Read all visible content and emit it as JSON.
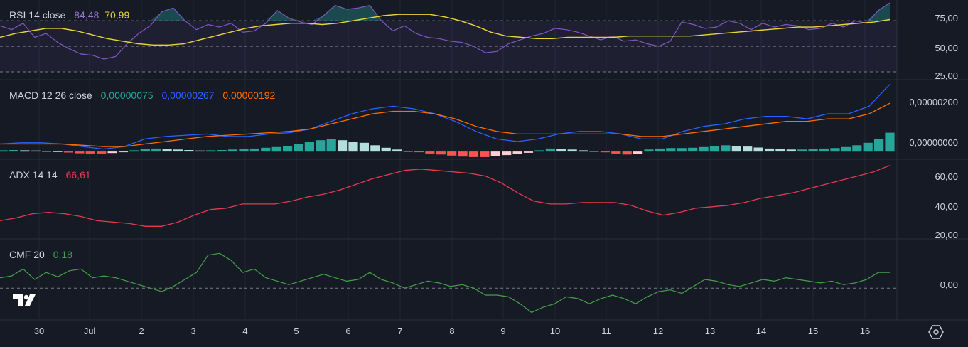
{
  "colors": {
    "background": "#161a25",
    "grid": "#232733",
    "rsi_line": "#7e57c2",
    "rsi_ma": "#e8d534",
    "macd_line": "#2962ff",
    "signal_line": "#ff6d00",
    "hist_pos_strong": "#26a69a",
    "hist_pos_weak": "#b2dfdb",
    "hist_neg_strong": "#ff5252",
    "hist_neg_weak": "#ffcdd2",
    "adx_line": "#e53950",
    "cmf_line": "#43a047"
  },
  "icons": {
    "logo": "tradingview-logo-icon",
    "settings": "settings-hexagon-icon"
  },
  "chart_data": [
    {
      "type": "line",
      "pane": "rsi",
      "title": "RSI 14 close",
      "legend_values": [
        "84,48",
        "70,99"
      ],
      "ylim": [
        25,
        84
      ],
      "yticks": [
        "75,00",
        "50,00",
        "25,00"
      ],
      "bands": [
        30,
        50,
        70
      ],
      "x": [
        "30",
        "Jul",
        "2",
        "3",
        "4",
        "5",
        "6",
        "7",
        "8",
        "9",
        "10",
        "11",
        "12",
        "13",
        "14",
        "15",
        "16"
      ],
      "series": [
        {
          "name": "RSI",
          "values": [
            66,
            63,
            68,
            57,
            60,
            53,
            48,
            44,
            43,
            40,
            42,
            52,
            60,
            66,
            77,
            80,
            70,
            63,
            67,
            65,
            68,
            61,
            62,
            68,
            78,
            72,
            69,
            67,
            74,
            82,
            79,
            80,
            82,
            70,
            62,
            66,
            60,
            57,
            56,
            54,
            53,
            50,
            45,
            46,
            52,
            55,
            58,
            60,
            64,
            63,
            61,
            58,
            55,
            58,
            54,
            55,
            52,
            50,
            54,
            69,
            67,
            64,
            65,
            70,
            68,
            63,
            68,
            65,
            67,
            66,
            63,
            64,
            68,
            65,
            70,
            68,
            78,
            84
          ]
        },
        {
          "name": "MA",
          "values": [
            57,
            60,
            62,
            64,
            64,
            62,
            59,
            56,
            54,
            52,
            51,
            51,
            52,
            55,
            58,
            61,
            64,
            66,
            67,
            68,
            68,
            67,
            68,
            70,
            72,
            74,
            75,
            75,
            75,
            73,
            70,
            66,
            61,
            58,
            57,
            56,
            56,
            57,
            57,
            57,
            57,
            58,
            58,
            58,
            58,
            58,
            59,
            60,
            61,
            62,
            63,
            64,
            65,
            65,
            66,
            67,
            68,
            69,
            71
          ]
        }
      ]
    },
    {
      "type": "bar",
      "pane": "macd",
      "title": "MACD 12 26 close",
      "legend_values": [
        "0,00000075",
        "0,00000267",
        "0,00000192"
      ],
      "ylim": [
        -2.5e-07,
        2.8e-06
      ],
      "yticks": [
        "0,00000200",
        "0,00000000"
      ],
      "series": [
        {
          "name": "MACD",
          "values": [
            3e-07,
            3.5e-07,
            3.5e-07,
            3e-07,
            2e-07,
            1e-07,
            2e-07,
            5e-07,
            6e-07,
            6.5e-07,
            7e-07,
            6e-07,
            6e-07,
            7e-07,
            7.5e-07,
            9e-07,
            1.2e-06,
            1.5e-06,
            1.7e-06,
            1.8e-06,
            1.7e-06,
            1.5e-06,
            1.2e-06,
            8e-07,
            5e-07,
            4e-07,
            5e-07,
            7e-07,
            8e-07,
            8e-07,
            7e-07,
            5e-07,
            5e-07,
            8e-07,
            1e-06,
            1.1e-06,
            1.3e-06,
            1.4e-06,
            1.4e-06,
            1.3e-06,
            1.5e-06,
            1.5e-06,
            1.8e-06,
            2.67e-06
          ]
        },
        {
          "name": "Signal",
          "values": [
            3e-07,
            3e-07,
            3e-07,
            3e-07,
            2.5e-07,
            2e-07,
            2e-07,
            3e-07,
            4e-07,
            5e-07,
            6e-07,
            6.5e-07,
            7e-07,
            7.5e-07,
            8e-07,
            9e-07,
            1.1e-06,
            1.3e-06,
            1.5e-06,
            1.6e-06,
            1.6e-06,
            1.5e-06,
            1.3e-06,
            1e-06,
            8e-07,
            7e-07,
            7e-07,
            7e-07,
            7e-07,
            7e-07,
            7e-07,
            6e-07,
            6e-07,
            7e-07,
            8e-07,
            9e-07,
            1e-06,
            1.1e-06,
            1.2e-06,
            1.2e-06,
            1.3e-06,
            1.3e-06,
            1.5e-06,
            1.92e-06
          ]
        },
        {
          "name": "Histogram",
          "values": [
            5e-08,
            6e-08,
            5e-08,
            4e-08,
            2e-08,
            1e-08,
            -4e-08,
            -7e-08,
            -8e-08,
            -8e-08,
            -6e-08,
            -2e-08,
            5e-08,
            1e-07,
            1.2e-07,
            1e-07,
            8e-08,
            6e-08,
            4e-08,
            5e-08,
            6e-08,
            8e-08,
            1e-07,
            1.2e-07,
            1.5e-07,
            1.8e-07,
            2.2e-07,
            3e-07,
            3.8e-07,
            4.5e-07,
            5e-07,
            4.5e-07,
            4e-07,
            3.5e-07,
            2.5e-07,
            1.5e-07,
            8e-08,
            2e-08,
            -2e-08,
            -8e-08,
            -1.2e-07,
            -1.6e-07,
            -2e-07,
            -2.2e-07,
            -2.2e-07,
            -1.8e-07,
            -1.4e-07,
            -1e-07,
            -5e-08,
            5e-08,
            1.2e-07,
            1e-07,
            8e-08,
            5e-08,
            2e-08,
            -3e-08,
            -8e-08,
            -1.2e-07,
            -1e-07,
            8e-08,
            1.2e-07,
            1.4e-07,
            1.4e-07,
            1.5e-07,
            1.8e-07,
            2.2e-07,
            2.5e-07,
            2.2e-07,
            2e-07,
            1.6e-07,
            1.2e-07,
            1e-07,
            8e-08,
            8e-08,
            1e-07,
            1.2e-07,
            1.4e-07,
            1.8e-07,
            2.5e-07,
            3.5e-07,
            5e-07,
            7.5e-07
          ]
        }
      ]
    },
    {
      "type": "line",
      "pane": "adx",
      "title": "ADX 14 14",
      "legend_values": [
        "66,61"
      ],
      "ylim": [
        15,
        70
      ],
      "yticks": [
        "60,00",
        "40,00",
        "20,00"
      ],
      "series": [
        {
          "name": "ADX",
          "values": [
            27,
            29,
            32,
            33,
            32,
            30,
            27,
            26,
            25,
            23,
            23,
            26,
            31,
            35,
            36,
            39,
            39,
            39,
            41,
            44,
            46,
            49,
            53,
            57,
            60,
            63,
            64,
            63,
            62,
            61,
            59,
            54,
            47,
            41,
            39,
            39,
            40,
            40,
            40,
            38,
            34,
            31,
            33,
            36,
            37,
            38,
            40,
            43,
            45,
            47,
            50,
            53,
            56,
            59,
            62,
            66.61
          ]
        }
      ]
    },
    {
      "type": "line",
      "pane": "cmf",
      "title": "CMF 20",
      "legend_values": [
        "0,18"
      ],
      "ylim": [
        -0.35,
        0.55
      ],
      "yticks": [
        "0,00"
      ],
      "series": [
        {
          "name": "CMF",
          "values": [
            0.12,
            0.14,
            0.22,
            0.1,
            0.18,
            0.13,
            0.2,
            0.22,
            0.12,
            0.14,
            0.12,
            0.08,
            0.04,
            0.0,
            -0.04,
            0.02,
            0.1,
            0.18,
            0.38,
            0.4,
            0.32,
            0.18,
            0.22,
            0.12,
            0.08,
            0.04,
            0.08,
            0.12,
            0.16,
            0.12,
            0.08,
            0.1,
            0.18,
            0.1,
            0.06,
            0.0,
            0.04,
            0.08,
            0.06,
            0.02,
            0.04,
            0.0,
            -0.08,
            -0.08,
            -0.1,
            -0.18,
            -0.28,
            -0.22,
            -0.18,
            -0.1,
            -0.12,
            -0.18,
            -0.12,
            -0.08,
            -0.12,
            -0.18,
            -0.1,
            -0.04,
            -0.02,
            -0.06,
            0.02,
            0.1,
            0.08,
            0.04,
            0.02,
            0.06,
            0.1,
            0.08,
            0.12,
            0.1,
            0.08,
            0.06,
            0.08,
            0.04,
            0.06,
            0.1,
            0.18,
            0.18
          ]
        }
      ]
    }
  ],
  "x_axis": {
    "ticks": [
      "30",
      "Jul",
      "2",
      "3",
      "4",
      "5",
      "6",
      "7",
      "8",
      "9",
      "10",
      "11",
      "12",
      "13",
      "14",
      "15",
      "16"
    ]
  }
}
